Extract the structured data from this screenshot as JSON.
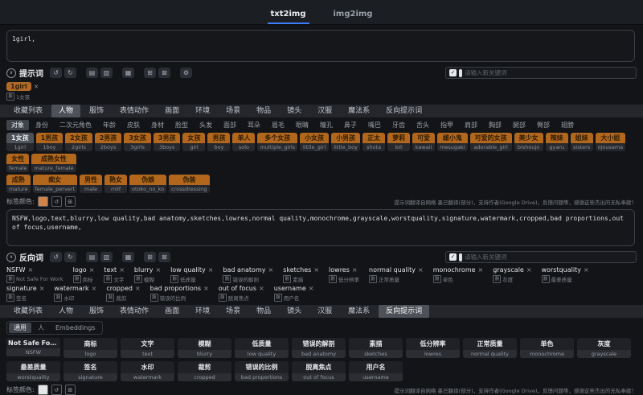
{
  "icons": {
    "close": "×",
    "chevron_down": "∨",
    "check": "✓",
    "translate_badge": "翻",
    "undo": "↺",
    "redo": "↻",
    "save": "▤",
    "load": "▥",
    "translate": "▦",
    "copy": "⊞",
    "delete": "⊠",
    "settings": "⚙"
  },
  "topbar": {
    "tabs": [
      {
        "label": "txt2img",
        "active": true
      },
      {
        "label": "img2img"
      }
    ]
  },
  "prompt": {
    "label": "提示词",
    "value": "1girl,",
    "new_keyword_placeholder": "请输入新关键词",
    "toolbar": [
      {
        "name": "undo",
        "glyph": "↺"
      },
      {
        "name": "redo",
        "glyph": "↻"
      },
      {
        "name": "save",
        "glyph": "▤",
        "cls": "gap"
      },
      {
        "name": "load",
        "glyph": "▥"
      },
      {
        "name": "translate",
        "glyph": "▦",
        "cls": "gap"
      },
      {
        "name": "copy",
        "glyph": "⊞",
        "cls": "gap"
      },
      {
        "name": "delete",
        "glyph": "⊠"
      },
      {
        "name": "settings",
        "glyph": "⚙",
        "cls": "gap"
      }
    ],
    "tags": [
      {
        "en": "1girl",
        "zh": "1女孩"
      }
    ]
  },
  "tabs_top": [
    {
      "label": "收藏列表"
    },
    {
      "label": "人物",
      "active": true
    },
    {
      "label": "服饰"
    },
    {
      "label": "表情动作"
    },
    {
      "label": "画面"
    },
    {
      "label": "环境"
    },
    {
      "label": "场景"
    },
    {
      "label": "物品"
    },
    {
      "label": "镜头"
    },
    {
      "label": "汉服"
    },
    {
      "label": "魔法系"
    },
    {
      "label": "反向提示词"
    }
  ],
  "person_subtabs": [
    {
      "label": "对象",
      "active": true
    },
    {
      "label": "身份"
    },
    {
      "label": "二次元角色"
    },
    {
      "label": "年龄"
    },
    {
      "label": "皮肤"
    },
    {
      "label": "身材"
    },
    {
      "label": "脸型"
    },
    {
      "label": "头发"
    },
    {
      "label": "面部"
    },
    {
      "label": "耳朵"
    },
    {
      "label": "眉毛"
    },
    {
      "label": "眼睛"
    },
    {
      "label": "瞳孔"
    },
    {
      "label": "鼻子"
    },
    {
      "label": "嘴巴"
    },
    {
      "label": "牙齿"
    },
    {
      "label": "舌头"
    },
    {
      "label": "指甲"
    },
    {
      "label": "肩部"
    },
    {
      "label": "胸部"
    },
    {
      "label": "腿部"
    },
    {
      "label": "臀部"
    },
    {
      "label": "翅膀"
    }
  ],
  "keywords_row1": [
    {
      "zh": "1女孩",
      "en": "1girl",
      "selected": true
    },
    {
      "zh": "1男孩",
      "en": "1boy"
    },
    {
      "zh": "2女孩",
      "en": "2girls"
    },
    {
      "zh": "2男孩",
      "en": "2boys"
    },
    {
      "zh": "3女孩",
      "en": "3girls"
    },
    {
      "zh": "3男孩",
      "en": "3boys"
    },
    {
      "zh": "女孩",
      "en": "girl"
    },
    {
      "zh": "男孩",
      "en": "boy"
    },
    {
      "zh": "单人",
      "en": "solo"
    },
    {
      "zh": "多个女孩",
      "en": "multiple_girls"
    },
    {
      "zh": "小女孩",
      "en": "little_girl"
    },
    {
      "zh": "小男孩",
      "en": "little_boy"
    },
    {
      "zh": "正太",
      "en": "shota"
    },
    {
      "zh": "萝莉",
      "en": "loli"
    },
    {
      "zh": "可爱",
      "en": "kawaii"
    },
    {
      "zh": "雌小鬼",
      "en": "mesugaki"
    },
    {
      "zh": "可爱的女孩",
      "en": "adorable_girl"
    },
    {
      "zh": "美少女",
      "en": "bishoujo"
    },
    {
      "zh": "辣妹",
      "en": "gyaru"
    },
    {
      "zh": "姐妹",
      "en": "sisters"
    },
    {
      "zh": "大小姐",
      "en": "ojousama"
    },
    {
      "zh": "女性",
      "en": "female"
    },
    {
      "zh": "成熟女性",
      "en": "mature_female"
    }
  ],
  "keywords_row2": [
    {
      "zh": "成熟",
      "en": "mature"
    },
    {
      "zh": "痴女",
      "en": "female_pervert"
    },
    {
      "zh": "男性",
      "en": "male"
    },
    {
      "zh": "熟女",
      "en": "milf"
    },
    {
      "zh": "伪娘",
      "en": "otoko_no_ko"
    },
    {
      "zh": "伪装",
      "en": "crossdressing"
    }
  ],
  "tag_color": {
    "label": "标签颜色:"
  },
  "hint_text": "提示词翻译自网络 墨已翻译(部分)，支持作者(Google Drive)，反馈问题等，感谢这些杰出的无私奉献！",
  "negative": {
    "label": "反向词",
    "value": "NSFW,logo,text,blurry,low quality,bad anatomy,sketches,lowres,normal quality,monochrome,grayscale,worstquality,signature,watermark,cropped,bad proportions,out of focus,username,",
    "new_keyword_placeholder": "请输入新关键词",
    "toolbar": [
      {
        "name": "undo",
        "glyph": "↺"
      },
      {
        "name": "redo",
        "glyph": "↻"
      },
      {
        "name": "save",
        "glyph": "▤",
        "cls": "gap"
      },
      {
        "name": "load",
        "glyph": "▥"
      },
      {
        "name": "translate",
        "glyph": "▦",
        "cls": "gap"
      },
      {
        "name": "copy",
        "glyph": "⊞",
        "cls": "gap"
      },
      {
        "name": "delete",
        "glyph": "⊠"
      }
    ],
    "tags": [
      {
        "en": "NSFW",
        "zh": "Not Safe For Work"
      },
      {
        "en": "logo",
        "zh": "商标"
      },
      {
        "en": "text",
        "zh": "文字"
      },
      {
        "en": "blurry",
        "zh": "模糊"
      },
      {
        "en": "low quality",
        "zh": "低质量"
      },
      {
        "en": "bad anatomy",
        "zh": "错误的解剖"
      },
      {
        "en": "sketches",
        "zh": "素描"
      },
      {
        "en": "lowres",
        "zh": "低分辨率"
      },
      {
        "en": "normal quality",
        "zh": "正常质量"
      },
      {
        "en": "monochrome",
        "zh": "单色"
      },
      {
        "en": "grayscale",
        "zh": "灰度"
      },
      {
        "en": "worstquality",
        "zh": "最差质量"
      },
      {
        "en": "signature",
        "zh": "签名"
      },
      {
        "en": "watermark",
        "zh": "水印"
      },
      {
        "en": "cropped",
        "zh": "裁剪"
      },
      {
        "en": "bad proportions",
        "zh": "错误的比例"
      },
      {
        "en": "out of focus",
        "zh": "脱离焦点"
      },
      {
        "en": "username",
        "zh": "用户名"
      }
    ]
  },
  "tabs_bottom": [
    {
      "label": "收藏列表"
    },
    {
      "label": "人物"
    },
    {
      "label": "服饰"
    },
    {
      "label": "表情动作"
    },
    {
      "label": "画面"
    },
    {
      "label": "环境"
    },
    {
      "label": "场景"
    },
    {
      "label": "物品"
    },
    {
      "label": "镜头"
    },
    {
      "label": "汉服"
    },
    {
      "label": "魔法系"
    },
    {
      "label": "反向提示词",
      "active": true
    }
  ],
  "negative_subtabs": [
    {
      "label": "通用",
      "active": true
    },
    {
      "label": "人"
    },
    {
      "label": "Embeddings"
    }
  ],
  "cards_row1": [
    {
      "zh": "Not Safe For W...",
      "en": "NSFW"
    },
    {
      "zh": "商标",
      "en": "logo"
    },
    {
      "zh": "文字",
      "en": "text"
    },
    {
      "zh": "模糊",
      "en": "blurry"
    },
    {
      "zh": "低质量",
      "en": "low quality"
    },
    {
      "zh": "错误的解剖",
      "en": "bad anatomy"
    },
    {
      "zh": "素描",
      "en": "sketches"
    },
    {
      "zh": "低分辨率",
      "en": "lowres"
    },
    {
      "zh": "正常质量",
      "en": "normal quality"
    },
    {
      "zh": "单色",
      "en": "monochrome"
    },
    {
      "zh": "灰度",
      "en": "grayscale"
    }
  ],
  "cards_row2": [
    {
      "zh": "最差质量",
      "en": "worstquality"
    },
    {
      "zh": "签名",
      "en": "signature"
    },
    {
      "zh": "水印",
      "en": "watermark"
    },
    {
      "zh": "裁剪",
      "en": "cropped"
    },
    {
      "zh": "错误的比例",
      "en": "bad proportions"
    },
    {
      "zh": "脱离焦点",
      "en": "out of focus"
    },
    {
      "zh": "用户名",
      "en": "username"
    }
  ]
}
